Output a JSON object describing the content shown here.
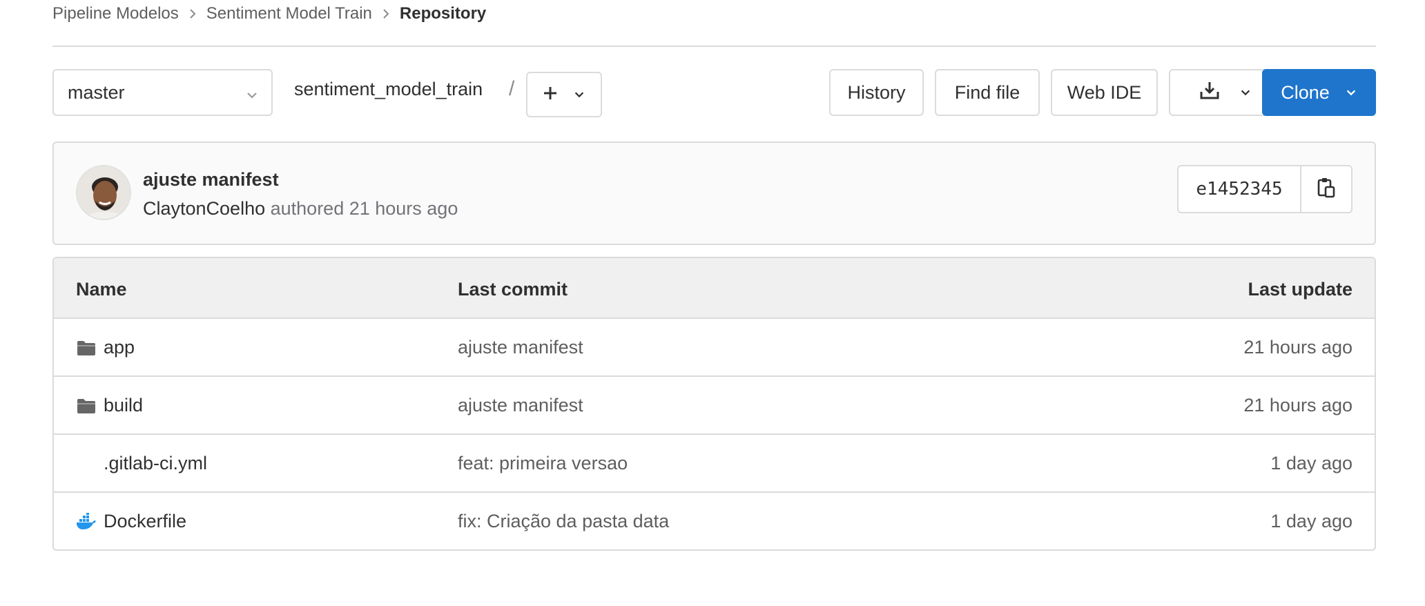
{
  "breadcrumb": {
    "items": [
      "Pipeline Modelos",
      "Sentiment Model Train"
    ],
    "current": "Repository"
  },
  "toolbar": {
    "branch": "master",
    "repo_name": "sentiment_model_train",
    "path_separator": "/",
    "history_label": "History",
    "find_file_label": "Find file",
    "web_ide_label": "Web IDE",
    "clone_label": "Clone",
    "accent_color": "#1f75cb"
  },
  "last_commit": {
    "title": "ajuste manifest",
    "author": "ClaytonCoelho",
    "meta": "authored 21 hours ago",
    "sha": "e1452345"
  },
  "table": {
    "headers": {
      "name": "Name",
      "last_commit": "Last commit",
      "last_update": "Last update"
    },
    "rows": [
      {
        "icon": "folder-icon",
        "name": "app",
        "commit": "ajuste manifest",
        "updated": "21 hours ago"
      },
      {
        "icon": "folder-icon",
        "name": "build",
        "commit": "ajuste manifest",
        "updated": "21 hours ago"
      },
      {
        "icon": "file-icon",
        "name": ".gitlab-ci.yml",
        "commit": "feat: primeira versao",
        "updated": "1 day ago"
      },
      {
        "icon": "docker-icon",
        "name": "Dockerfile",
        "commit": "fix: Criação da pasta data",
        "updated": "1 day ago"
      }
    ]
  }
}
